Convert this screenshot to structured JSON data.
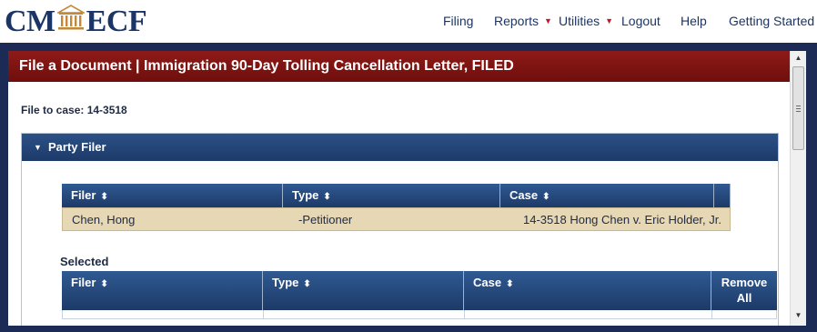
{
  "logo": {
    "left": "CM",
    "right": "ECF"
  },
  "nav": {
    "items": [
      {
        "label": "Filing",
        "dropdown": false
      },
      {
        "label": "Reports",
        "dropdown": true
      },
      {
        "label": "Utilities",
        "dropdown": true
      },
      {
        "label": "Logout",
        "dropdown": false
      },
      {
        "label": "Help",
        "dropdown": false
      },
      {
        "label": "Getting Started",
        "dropdown": false
      }
    ]
  },
  "window": {
    "title": "File a Document | Immigration 90-Day Tolling Cancellation Letter, FILED",
    "case_line": "File to case: 14-3518"
  },
  "panel": {
    "title": "Party Filer",
    "filers_table": {
      "columns": [
        "Filer",
        "Type",
        "Case"
      ],
      "rows": [
        [
          "Chen, Hong",
          "-Petitioner",
          "14-3518 Hong Chen v. Eric Holder, Jr."
        ]
      ]
    },
    "selected_label": "Selected",
    "selected_table": {
      "columns": [
        "Filer",
        "Type",
        "Case"
      ],
      "remove_all": [
        "Remove",
        "All"
      ]
    }
  },
  "colors": {
    "brand_navy": "#1b3566",
    "title_red": "#7d1412",
    "header_blue": "#1d3a68",
    "row_highlight": "#e6d7b5",
    "caret_red": "#c4162b"
  },
  "icons": {
    "logo": "courthouse-icon",
    "sort": "sort-updown-icon",
    "collapse": "triangle-down-icon"
  }
}
